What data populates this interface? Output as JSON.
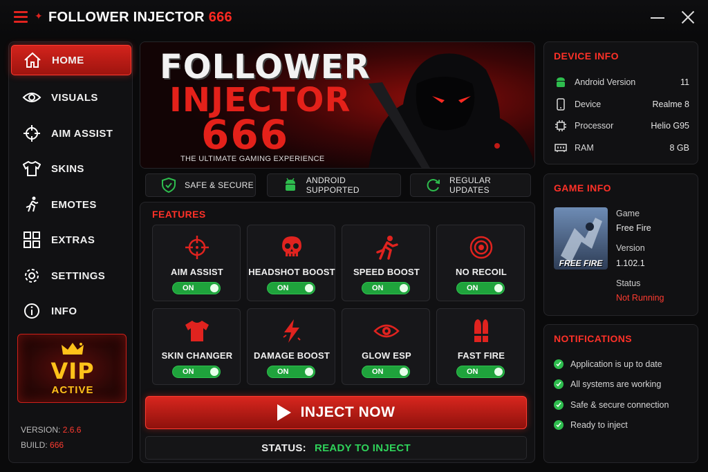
{
  "titlebar": {
    "title_main": "FOLLOWER INJECTOR",
    "title_accent": "666"
  },
  "sidebar": {
    "items": [
      {
        "label": "HOME",
        "icon": "home-icon",
        "active": true
      },
      {
        "label": "VISUALS",
        "icon": "eye-icon"
      },
      {
        "label": "AIM ASSIST",
        "icon": "crosshair-icon"
      },
      {
        "label": "SKINS",
        "icon": "shirt-icon"
      },
      {
        "label": "EMOTES",
        "icon": "running-figure-icon"
      },
      {
        "label": "EXTRAS",
        "icon": "grid-icon"
      },
      {
        "label": "SETTINGS",
        "icon": "gear-icon"
      },
      {
        "label": "INFO",
        "icon": "info-icon"
      }
    ],
    "vip": {
      "title": "VIP",
      "status": "ACTIVE"
    },
    "version_label": "VERSION:",
    "version_value": "2.6.6",
    "build_label": "BUILD:",
    "build_value": "666"
  },
  "banner": {
    "line1": "FOLLOWER",
    "line2": "INJECTOR",
    "line3": "666",
    "tagline": "THE ULTIMATE GAMING EXPERIENCE"
  },
  "badges": [
    {
      "label": "SAFE & SECURE",
      "icon": "shield-check-icon"
    },
    {
      "label": "ANDROID SUPPORTED",
      "icon": "android-icon"
    },
    {
      "label": "REGULAR UPDATES",
      "icon": "refresh-icon"
    }
  ],
  "features": {
    "title": "FEATURES",
    "items": [
      {
        "label": "AIM ASSIST",
        "icon": "crosshair-icon",
        "state": "ON"
      },
      {
        "label": "HEADSHOT BOOST",
        "icon": "skull-icon",
        "state": "ON"
      },
      {
        "label": "SPEED BOOST",
        "icon": "running-figure-icon",
        "state": "ON"
      },
      {
        "label": "NO RECOIL",
        "icon": "target-icon",
        "state": "ON"
      },
      {
        "label": "SKIN CHANGER",
        "icon": "shirt-icon",
        "state": "ON"
      },
      {
        "label": "DAMAGE BOOST",
        "icon": "lightning-icon",
        "state": "ON"
      },
      {
        "label": "GLOW ESP",
        "icon": "eye-icon",
        "state": "ON"
      },
      {
        "label": "FAST FIRE",
        "icon": "bullet-icon",
        "state": "ON"
      }
    ]
  },
  "inject": {
    "label": "INJECT NOW"
  },
  "status": {
    "label": "STATUS:",
    "value": "READY TO INJECT"
  },
  "device_info": {
    "title": "DEVICE INFO",
    "rows": [
      {
        "key": "Android Version",
        "value": "11",
        "icon": "android-icon"
      },
      {
        "key": "Device",
        "value": "Realme 8",
        "icon": "phone-icon"
      },
      {
        "key": "Processor",
        "value": "Helio G95",
        "icon": "chip-icon"
      },
      {
        "key": "RAM",
        "value": "8 GB",
        "icon": "memory-icon"
      }
    ]
  },
  "game_info": {
    "title": "GAME INFO",
    "thumb_text": "FREE FIRE",
    "game_label": "Game",
    "game_value": "Free Fire",
    "version_label": "Version",
    "version_value": "1.102.1",
    "status_label": "Status",
    "status_value": "Not Running"
  },
  "notifications": {
    "title": "NOTIFICATIONS",
    "items": [
      "Application is up to date",
      "All systems are working",
      "Safe & secure connection",
      "Ready to inject"
    ]
  },
  "colors": {
    "accent": "#e0231f",
    "success": "#2ebd4e",
    "gold": "#ffc21a"
  }
}
